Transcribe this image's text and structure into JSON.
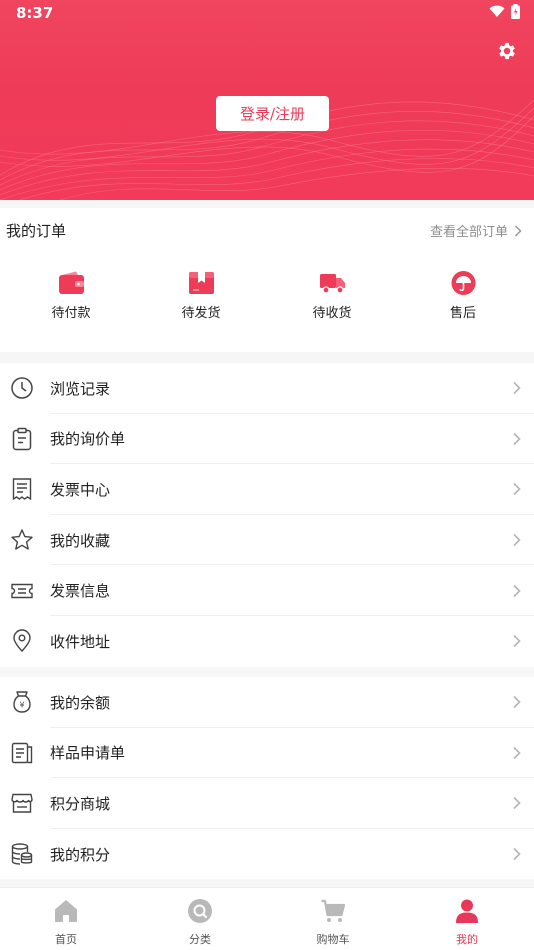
{
  "status_bar": {
    "time": "8:37"
  },
  "header": {
    "login_label": "登录/注册",
    "settings_icon": "gear-icon"
  },
  "orders": {
    "title": "我的订单",
    "view_all": "查看全部订单",
    "items": [
      {
        "label": "待付款",
        "icon": "wallet-icon"
      },
      {
        "label": "待发货",
        "icon": "package-icon"
      },
      {
        "label": "待收货",
        "icon": "truck-icon"
      },
      {
        "label": "售后",
        "icon": "umbrella-icon"
      }
    ]
  },
  "menu_group_1": [
    {
      "label": "浏览记录",
      "icon": "clock-icon"
    },
    {
      "label": "我的询价单",
      "icon": "clipboard-icon"
    },
    {
      "label": "发票中心",
      "icon": "receipt-icon"
    },
    {
      "label": "我的收藏",
      "icon": "star-icon"
    },
    {
      "label": "发票信息",
      "icon": "ticket-icon"
    },
    {
      "label": "收件地址",
      "icon": "location-pin-icon"
    }
  ],
  "menu_group_2": [
    {
      "label": "我的余额",
      "icon": "money-bag-icon"
    },
    {
      "label": "样品申请单",
      "icon": "document-list-icon"
    },
    {
      "label": "积分商城",
      "icon": "store-icon"
    },
    {
      "label": "我的积分",
      "icon": "coins-stack-icon"
    }
  ],
  "tabbar": [
    {
      "label": "首页",
      "icon": "home-icon"
    },
    {
      "label": "分类",
      "icon": "search-circle-icon"
    },
    {
      "label": "购物车",
      "icon": "cart-icon"
    },
    {
      "label": "我的",
      "icon": "person-icon",
      "active": true
    }
  ],
  "colors": {
    "accent": "#ee3b58",
    "tab_inactive": "#b9b9b9"
  }
}
